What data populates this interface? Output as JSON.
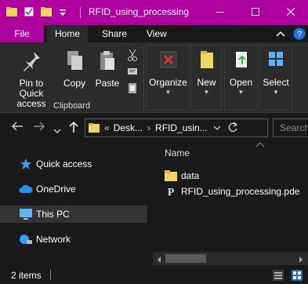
{
  "window": {
    "title": "RFID_using_processing",
    "minimize_icon": "minimize-icon",
    "maximize_icon": "maximize-icon",
    "close_icon": "close-icon",
    "title_bar_color": "#ad009e"
  },
  "ribbon_tabs": {
    "file": "File",
    "home": "Home",
    "share": "Share",
    "view": "View"
  },
  "ribbon": {
    "pin_label": "Pin to Quick access",
    "copy_label": "Copy",
    "paste_label": "Paste",
    "clipboard_group": "Clipboard",
    "organize_label": "Organize",
    "new_label": "New",
    "open_label": "Open",
    "select_label": "Select"
  },
  "address": {
    "overflow": "«",
    "crumb1": "Desk...",
    "crumb2": "RFID_usin...",
    "search_placeholder": "Search"
  },
  "nav_pane": {
    "items": [
      {
        "label": "Quick access",
        "icon": "star-icon"
      },
      {
        "label": "OneDrive",
        "icon": "cloud-icon"
      },
      {
        "label": "This PC",
        "icon": "monitor-icon"
      },
      {
        "label": "Network",
        "icon": "network-icon"
      }
    ]
  },
  "content": {
    "column_name": "Name",
    "files": [
      {
        "name": "data",
        "icon": "folder-icon"
      },
      {
        "name": "RFID_using_processing.pde",
        "icon": "processing-file-icon"
      }
    ]
  },
  "status": {
    "count": "2 items"
  }
}
